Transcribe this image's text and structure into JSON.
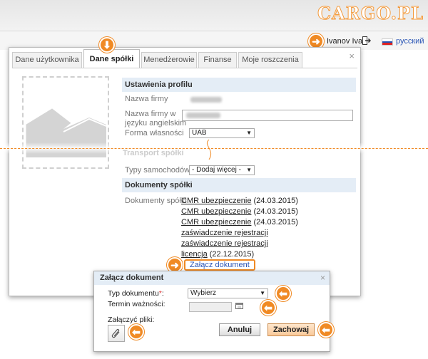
{
  "header": {
    "logo": "CARGO.PL",
    "user_name": "Ivanov Ivan",
    "language": "русский"
  },
  "tabs": [
    {
      "label": "Dane użytkownika",
      "active": false
    },
    {
      "label": "Dane spółki",
      "active": true
    },
    {
      "label": "Menedżerowie",
      "active": false
    },
    {
      "label": "Finanse",
      "active": false
    },
    {
      "label": "Moje roszczenia",
      "active": false
    }
  ],
  "dialog": {
    "close": "×"
  },
  "profile": {
    "section_title": "Ustawienia profilu",
    "company_name_label": "Nazwa firmy",
    "company_name_en_label": "Nazwa firmy w języku angielskim",
    "ownership_label": "Forma własności",
    "ownership_value": "UAB",
    "transport_section": "Transport spółki",
    "vehicle_types_label": "Typy samochodów",
    "vehicle_types_value": "- Dodaj więcej -"
  },
  "documents": {
    "section_title": "Dokumenty spółki",
    "label": "Dokumenty spółki",
    "items": [
      {
        "name": "CMR ubezpieczenie",
        "date": "(24.03.2015)"
      },
      {
        "name": "CMR ubezpieczenie",
        "date": "(24.03.2015)"
      },
      {
        "name": "CMR ubezpieczenie",
        "date": "(24.03.2015)"
      },
      {
        "name": "zaświadczenie rejestracji",
        "date": ""
      },
      {
        "name": "zaświadczenie rejestracji",
        "date": ""
      },
      {
        "name": "licencja",
        "date": "(22.12.2015)"
      }
    ],
    "attach_link": "Załącz dokument"
  },
  "attach_dialog": {
    "title": "Załącz dokument",
    "close": "×",
    "doc_type_label": "Typ dokumentu",
    "required_mark": "*",
    "colon": ":",
    "doc_type_value": "Wybierz",
    "validity_label": "Termin ważności:",
    "files_label": "Załączyć pliki:",
    "cancel": "Anuluj",
    "save": "Zachowaj"
  },
  "colors": {
    "accent": "#f08a24",
    "link": "#2a55b5",
    "section_bg": "#e4edf6"
  },
  "icons": {
    "arrow": "arrow-right-icon",
    "logout": "logout-icon",
    "calendar": "calendar-icon",
    "attach": "paperclip-icon"
  }
}
